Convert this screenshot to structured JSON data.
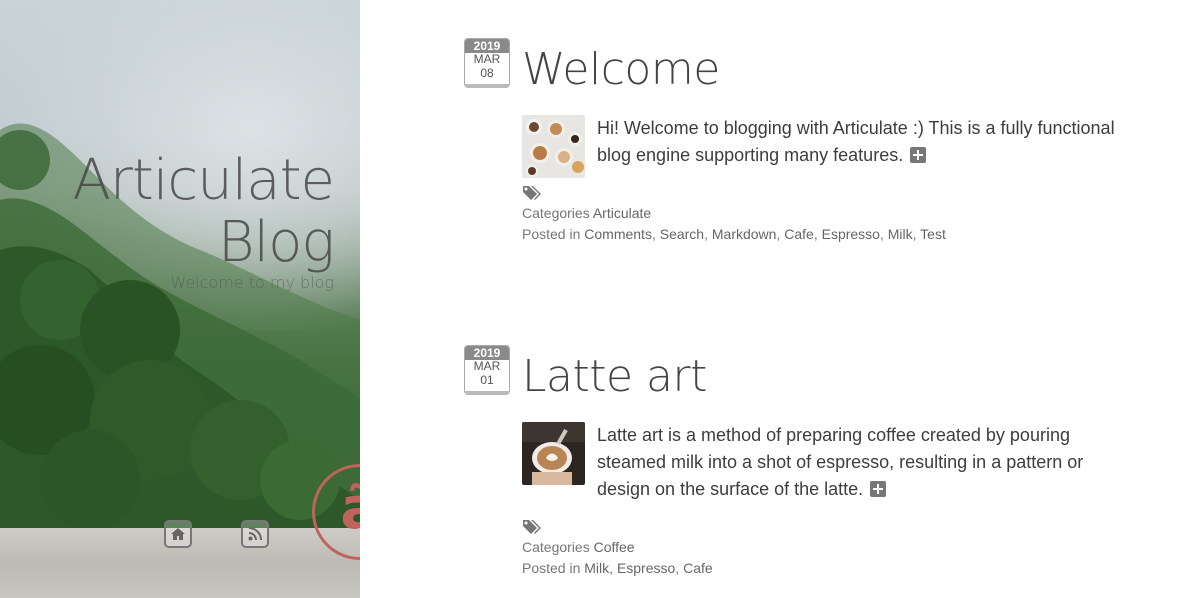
{
  "blog": {
    "title_line1": "Articulate",
    "title_line2": "Blog",
    "subtitle": "Welcome to my blog",
    "logo_letter": "ã",
    "nav": [
      {
        "icon": "home-icon"
      },
      {
        "icon": "rss-icon"
      }
    ]
  },
  "posts": [
    {
      "year": "2019",
      "month": "MAR",
      "day": "08",
      "title": "Welcome",
      "excerpt": "Hi! Welcome to blogging with Articulate :) This is a fully functional blog engine supporting many features.",
      "categories_label": "Categories",
      "categories": [
        "Articulate"
      ],
      "tags_label": "Posted in",
      "tags": [
        "Comments",
        "Search",
        "Markdown",
        "Cafe",
        "Espresso",
        "Milk",
        "Test"
      ]
    },
    {
      "year": "2019",
      "month": "MAR",
      "day": "01",
      "title": "Latte art",
      "excerpt": "Latte art is a method of preparing coffee created by pouring steamed milk into a shot of espresso, resulting in a pattern or design on the surface of the latte.",
      "categories_label": "Categories",
      "categories": [
        "Coffee"
      ],
      "tags_label": "Posted in",
      "tags": [
        "Milk",
        "Espresso",
        "Cafe"
      ]
    }
  ],
  "colors": {
    "logo_accent": "#c0635c",
    "badge_year_bg": "#8a8a8a"
  }
}
